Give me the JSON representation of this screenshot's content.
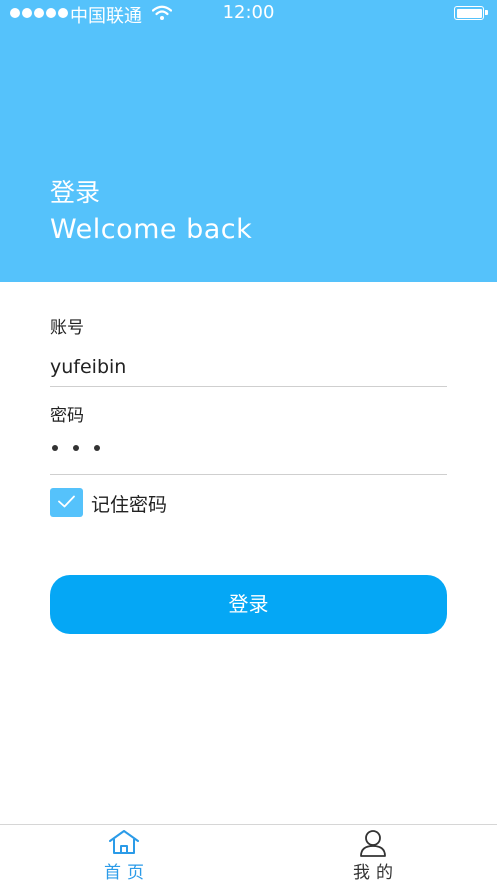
{
  "status_bar": {
    "carrier": "中国联通",
    "time": "12:00",
    "icons": [
      "signal-dots-icon",
      "wifi-icon",
      "battery-icon"
    ]
  },
  "header": {
    "title": "登录",
    "subtitle": "Welcome back"
  },
  "form": {
    "account_label": "账号",
    "account_value": "yufeibin",
    "password_label": "密码",
    "password_masked_count": 3,
    "remember_label": "记住密码",
    "remember_checked": true,
    "login_button": "登录"
  },
  "tabbar": {
    "tabs": [
      {
        "label": "首页",
        "icon": "home-icon",
        "active": true
      },
      {
        "label": "我的",
        "icon": "person-icon",
        "active": false
      }
    ]
  },
  "colors": {
    "header_bg": "#55c2fb",
    "button_bg": "#05a7f5",
    "active_tab": "#2b9be8"
  }
}
